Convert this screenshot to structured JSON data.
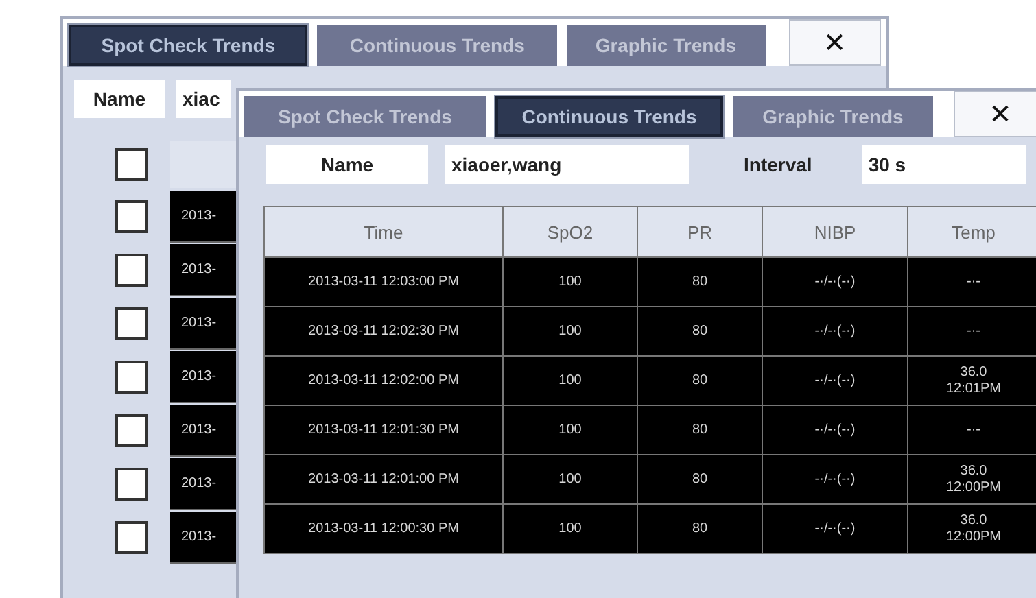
{
  "back_window": {
    "tabs": [
      {
        "label": "Spot Check Trends",
        "selected": true
      },
      {
        "label": "Continuous Trends",
        "selected": false
      },
      {
        "label": "Graphic Trends",
        "selected": false
      }
    ],
    "close": "✕",
    "name_label": "Name",
    "name_value": "xiac",
    "header_checkbox": {
      "checked": false
    },
    "rows": [
      {
        "checked": false,
        "column_1": "2013-"
      },
      {
        "checked": false,
        "column_1": "2013-"
      },
      {
        "checked": false,
        "column_1": "2013-"
      },
      {
        "checked": false,
        "column_1": "2013-"
      },
      {
        "checked": false,
        "column_1": "2013-"
      },
      {
        "checked": false,
        "column_1": "2013-"
      },
      {
        "checked": false,
        "column_1": "2013-"
      }
    ]
  },
  "front_window": {
    "tabs": [
      {
        "label": "Spot Check Trends",
        "selected": false
      },
      {
        "label": "Continuous Trends",
        "selected": true
      },
      {
        "label": "Graphic Trends",
        "selected": false
      }
    ],
    "close": "✕",
    "name_label": "Name",
    "name_value": "xiaoer,wang",
    "interval_label": "Interval",
    "interval_value": "30 s",
    "table": {
      "columns": [
        "Time",
        "SpO2",
        "PR",
        "NIBP",
        "Temp"
      ],
      "rows": [
        [
          "2013-03-11 12:03:00 PM",
          "100",
          "80",
          "-·/-·(-·)",
          "-·-"
        ],
        [
          "2013-03-11 12:02:30 PM",
          "100",
          "80",
          "-·/-·(-·)",
          "-·-"
        ],
        [
          "2013-03-11 12:02:00 PM",
          "100",
          "80",
          "-·/-·(-·)",
          "36.0\n12:01PM"
        ],
        [
          "2013-03-11 12:01:30 PM",
          "100",
          "80",
          "-·/-·(-·)",
          "-·-"
        ],
        [
          "2013-03-11 12:01:00 PM",
          "100",
          "80",
          "-·/-·(-·)",
          "36.0\n12:00PM"
        ],
        [
          "2013-03-11 12:00:30 PM",
          "100",
          "80",
          "-·/-·(-·)",
          "36.0\n12:00PM"
        ]
      ]
    }
  }
}
